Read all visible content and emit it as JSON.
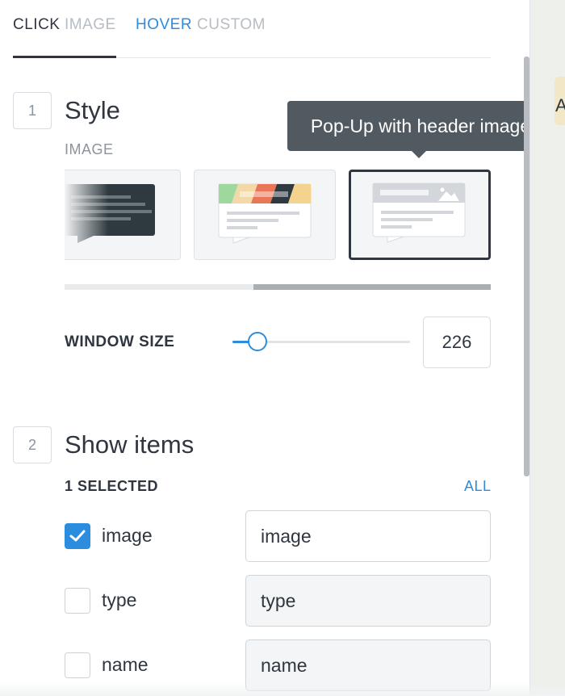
{
  "tabs": [
    {
      "label": "CLICK",
      "active": true
    },
    {
      "label": "IMAGE",
      "active": false
    },
    {
      "label": "HOVER",
      "active": true
    },
    {
      "label": "CUSTOM",
      "active": false
    }
  ],
  "section_style": {
    "number": "1",
    "title": "Style",
    "caption": "IMAGE",
    "tooltip": "Pop-Up with header image",
    "selected_card": 3
  },
  "window_size": {
    "label": "WINDOW SIZE",
    "value": "226",
    "slider_fraction": 0.14
  },
  "section_items": {
    "number": "2",
    "title": "Show items",
    "selected_label": "1 SELECTED",
    "all_label": "ALL",
    "items": [
      {
        "label": "image",
        "value": "image",
        "checked": true
      },
      {
        "label": "type",
        "value": "type",
        "checked": false
      },
      {
        "label": "name",
        "value": "name",
        "checked": false
      }
    ]
  },
  "map_partial_text": "A",
  "colors": {
    "accent": "#2c8dde",
    "text": "#2f3640",
    "muted": "#b7bdc4",
    "tooltip_bg": "#525a61"
  }
}
